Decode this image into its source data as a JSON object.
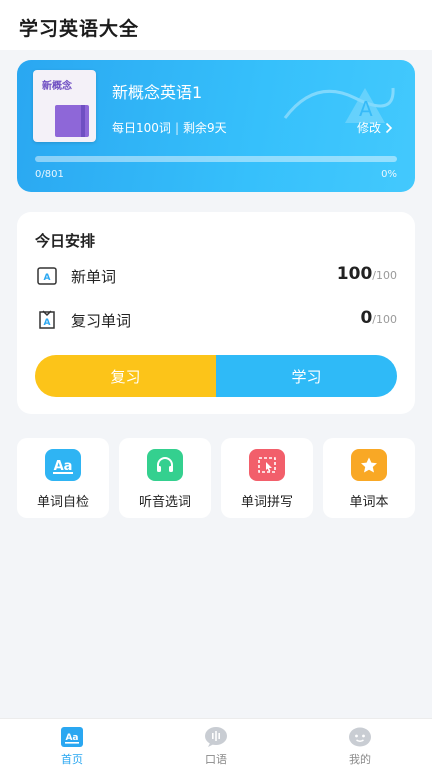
{
  "app": {
    "title": "学习英语大全"
  },
  "book": {
    "cover_label": "新概念",
    "name": "新概念英语1",
    "daily_plan_prefix": "每日",
    "daily_words": "100",
    "daily_plan_suffix": "词",
    "separator": "|",
    "remaining_label": "剩余9天",
    "modify_label": "修改",
    "progress_count": "0/801",
    "progress_percent": "0%",
    "progress_fraction": 0.0
  },
  "plan": {
    "title": "今日安排",
    "rows": [
      {
        "icon": "new-word-icon",
        "label": "新单词",
        "done": "100",
        "total": "/100"
      },
      {
        "icon": "review-word-icon",
        "label": "复习单词",
        "done": "0",
        "total": "/100"
      }
    ],
    "review_button": "复习",
    "study_button": "学习"
  },
  "tools": [
    {
      "icon": "word-check-icon",
      "label": "单词自检",
      "color": "#2fb4f3"
    },
    {
      "icon": "listening-icon",
      "label": "听音选词",
      "color": "#34d08f"
    },
    {
      "icon": "spelling-icon",
      "label": "单词拼写",
      "color": "#f25f6b"
    },
    {
      "icon": "star-icon",
      "label": "单词本",
      "color": "#f9a825"
    }
  ],
  "bottom_nav": [
    {
      "icon": "home-icon",
      "label": "首页",
      "active": true
    },
    {
      "icon": "speech-icon",
      "label": "口语",
      "active": false
    },
    {
      "icon": "profile-icon",
      "label": "我的",
      "active": false
    }
  ],
  "colors": {
    "accent": "#2aa7f1",
    "review": "#fcc419",
    "study": "#2fbaf7"
  }
}
